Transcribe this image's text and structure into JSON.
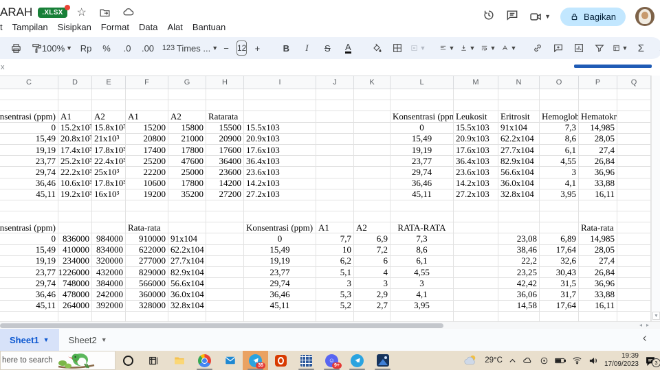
{
  "titlebar": {
    "title": "ARAH",
    "badge": ".XLSX",
    "share": "Bagikan"
  },
  "menubar": {
    "items": [
      "t",
      "Tampilan",
      "Sisipkan",
      "Format",
      "Data",
      "Alat",
      "Bantuan"
    ]
  },
  "toolbar": {
    "zoom": "100%",
    "currency": "Rp",
    "percent": "%",
    "decrease_decimal": ".0",
    "increase_decimal": ".00",
    "number_format": "123",
    "font": "Times ...",
    "minus": "−",
    "size": "12",
    "plus": "+",
    "bold": "B",
    "italic": "I",
    "strike": "S",
    "text_color": "A",
    "sum": "Σ",
    "collapse": "∧"
  },
  "formula_bar": {
    "remnant": "x"
  },
  "grid": {
    "column_headers": [
      "C",
      "D",
      "E",
      "F",
      "G",
      "H",
      "I",
      "J",
      "K",
      "L",
      "M",
      "N",
      "O",
      "P",
      "Q"
    ],
    "rows": [
      [],
      [],
      [
        [
          "C",
          "Konsentrasi (ppm)",
          "r"
        ],
        [
          "D",
          "A1",
          "l"
        ],
        [
          "E",
          "A2",
          "l"
        ],
        [
          "F",
          "A1",
          "l"
        ],
        [
          "G",
          "A2",
          "l"
        ],
        [
          "H",
          "Ratarata",
          "l"
        ],
        [
          "L",
          "Konsentrasi (ppm)",
          "l"
        ],
        [
          "M",
          "Leukosit",
          "l"
        ],
        [
          "N",
          "Eritrosit",
          "l"
        ],
        [
          "O",
          "Hemoglobin",
          "l"
        ],
        [
          "P",
          "Hematokrit",
          "l"
        ]
      ],
      [
        [
          "C",
          "0",
          "r"
        ],
        [
          "D",
          "15.2x10³",
          "l"
        ],
        [
          "E",
          "15.8x10³",
          "l"
        ],
        [
          "F",
          "15200",
          "r"
        ],
        [
          "G",
          "15800",
          "r"
        ],
        [
          "H",
          "15500",
          "r"
        ],
        [
          "I",
          "15.5x103",
          "l"
        ],
        [
          "L",
          "0",
          "c"
        ],
        [
          "M",
          "15.5x103",
          "l"
        ],
        [
          "N",
          "91x104",
          "l"
        ],
        [
          "O",
          "7,3",
          "r"
        ],
        [
          "P",
          "14,985",
          "r"
        ]
      ],
      [
        [
          "C",
          "15,49",
          "r"
        ],
        [
          "D",
          "20.8x10³",
          "l"
        ],
        [
          "E",
          "21x10³",
          "l"
        ],
        [
          "F",
          "20800",
          "r"
        ],
        [
          "G",
          "21000",
          "r"
        ],
        [
          "H",
          "20900",
          "r"
        ],
        [
          "I",
          "20.9x103",
          "l"
        ],
        [
          "L",
          "15,49",
          "c"
        ],
        [
          "M",
          "20.9x103",
          "l"
        ],
        [
          "N",
          "62.2x104",
          "l"
        ],
        [
          "O",
          "8,6",
          "r"
        ],
        [
          "P",
          "28,05",
          "r"
        ]
      ],
      [
        [
          "C",
          "19,19",
          "r"
        ],
        [
          "D",
          "17.4x10³",
          "l"
        ],
        [
          "E",
          "17.8x10³",
          "l"
        ],
        [
          "F",
          "17400",
          "r"
        ],
        [
          "G",
          "17800",
          "r"
        ],
        [
          "H",
          "17600",
          "r"
        ],
        [
          "I",
          "17.6x103",
          "l"
        ],
        [
          "L",
          "19,19",
          "c"
        ],
        [
          "M",
          "17.6x103",
          "l"
        ],
        [
          "N",
          "27.7x104",
          "l"
        ],
        [
          "O",
          "6,1",
          "r"
        ],
        [
          "P",
          "27,4",
          "r"
        ]
      ],
      [
        [
          "C",
          "23,77",
          "r"
        ],
        [
          "D",
          "25.2x10³",
          "l"
        ],
        [
          "E",
          "22.4x10³",
          "l"
        ],
        [
          "F",
          "25200",
          "r"
        ],
        [
          "G",
          "47600",
          "r"
        ],
        [
          "H",
          "36400",
          "r"
        ],
        [
          "I",
          "36.4x103",
          "l"
        ],
        [
          "L",
          "23,77",
          "c"
        ],
        [
          "M",
          "36.4x103",
          "l"
        ],
        [
          "N",
          "82.9x104",
          "l"
        ],
        [
          "O",
          "4,55",
          "r"
        ],
        [
          "P",
          "26,84",
          "r"
        ]
      ],
      [
        [
          "C",
          "29,74",
          "r"
        ],
        [
          "D",
          "22.2x10³",
          "l"
        ],
        [
          "E",
          "25x10³",
          "l"
        ],
        [
          "F",
          "22200",
          "r"
        ],
        [
          "G",
          "25000",
          "r"
        ],
        [
          "H",
          "23600",
          "r"
        ],
        [
          "I",
          "23.6x103",
          "l"
        ],
        [
          "L",
          "29,74",
          "c"
        ],
        [
          "M",
          "23.6x103",
          "l"
        ],
        [
          "N",
          "56.6x104",
          "l"
        ],
        [
          "O",
          "3",
          "r"
        ],
        [
          "P",
          "36,96",
          "r"
        ]
      ],
      [
        [
          "C",
          "36,46",
          "r"
        ],
        [
          "D",
          "10.6x10³",
          "l"
        ],
        [
          "E",
          "17.8x10³",
          "l"
        ],
        [
          "F",
          "10600",
          "r"
        ],
        [
          "G",
          "17800",
          "r"
        ],
        [
          "H",
          "14200",
          "r"
        ],
        [
          "I",
          "14.2x103",
          "l"
        ],
        [
          "L",
          "36,46",
          "c"
        ],
        [
          "M",
          "14.2x103",
          "l"
        ],
        [
          "N",
          "36.0x104",
          "l"
        ],
        [
          "O",
          "4,1",
          "r"
        ],
        [
          "P",
          "33,88",
          "r"
        ]
      ],
      [
        [
          "C",
          "45,11",
          "r"
        ],
        [
          "D",
          "19.2x10³",
          "l"
        ],
        [
          "E",
          "16x10³",
          "l"
        ],
        [
          "F",
          "19200",
          "r"
        ],
        [
          "G",
          "35200",
          "r"
        ],
        [
          "H",
          "27200",
          "r"
        ],
        [
          "I",
          "27.2x103",
          "l"
        ],
        [
          "L",
          "45,11",
          "c"
        ],
        [
          "M",
          "27.2x103",
          "l"
        ],
        [
          "N",
          "32.8x104",
          "l"
        ],
        [
          "O",
          "3,95",
          "r"
        ],
        [
          "P",
          "16,11",
          "r"
        ]
      ],
      [],
      [],
      [
        [
          "C",
          "Konsentrasi (ppm)",
          "r"
        ],
        [
          "F",
          "Rata-rata",
          "l"
        ],
        [
          "I",
          "Konsentrasi (ppm)",
          "l"
        ],
        [
          "J",
          "A1",
          "l"
        ],
        [
          "K",
          "A2",
          "l"
        ],
        [
          "L",
          "RATA-RATA",
          "c"
        ],
        [
          "P",
          "Rata-rata",
          "l"
        ]
      ],
      [
        [
          "C",
          "0",
          "r"
        ],
        [
          "D",
          "836000",
          "r"
        ],
        [
          "E",
          "984000",
          "r"
        ],
        [
          "F",
          "910000",
          "r"
        ],
        [
          "G",
          "91x104",
          "l"
        ],
        [
          "I",
          "0",
          "c"
        ],
        [
          "J",
          "7,7",
          "r"
        ],
        [
          "K",
          "6,9",
          "r"
        ],
        [
          "L",
          "7,3",
          "c"
        ],
        [
          "N",
          "23,08",
          "r"
        ],
        [
          "O",
          "6,89",
          "r"
        ],
        [
          "P",
          "14,985",
          "r"
        ]
      ],
      [
        [
          "C",
          "15,49",
          "r"
        ],
        [
          "D",
          "410000",
          "r"
        ],
        [
          "E",
          "834000",
          "r"
        ],
        [
          "F",
          "622000",
          "r"
        ],
        [
          "G",
          "62.2x104",
          "l"
        ],
        [
          "I",
          "15,49",
          "c"
        ],
        [
          "J",
          "10",
          "r"
        ],
        [
          "K",
          "7,2",
          "r"
        ],
        [
          "L",
          "8,6",
          "c"
        ],
        [
          "N",
          "38,46",
          "r"
        ],
        [
          "O",
          "17,64",
          "r"
        ],
        [
          "P",
          "28,05",
          "r"
        ]
      ],
      [
        [
          "C",
          "19,19",
          "r"
        ],
        [
          "D",
          "234000",
          "r"
        ],
        [
          "E",
          "320000",
          "r"
        ],
        [
          "F",
          "277000",
          "r"
        ],
        [
          "G",
          "27.7x104",
          "l"
        ],
        [
          "I",
          "19,19",
          "c"
        ],
        [
          "J",
          "6,2",
          "r"
        ],
        [
          "K",
          "6",
          "r"
        ],
        [
          "L",
          "6,1",
          "c"
        ],
        [
          "N",
          "22,2",
          "r"
        ],
        [
          "O",
          "32,6",
          "r"
        ],
        [
          "P",
          "27,4",
          "r"
        ]
      ],
      [
        [
          "C",
          "23,77",
          "r"
        ],
        [
          "D",
          "1226000",
          "r"
        ],
        [
          "E",
          "432000",
          "r"
        ],
        [
          "F",
          "829000",
          "r"
        ],
        [
          "G",
          "82.9x104",
          "l"
        ],
        [
          "I",
          "23,77",
          "c"
        ],
        [
          "J",
          "5,1",
          "r"
        ],
        [
          "K",
          "4",
          "r"
        ],
        [
          "L",
          "4,55",
          "c"
        ],
        [
          "N",
          "23,25",
          "r"
        ],
        [
          "O",
          "30,43",
          "r"
        ],
        [
          "P",
          "26,84",
          "r"
        ]
      ],
      [
        [
          "C",
          "29,74",
          "r"
        ],
        [
          "D",
          "748000",
          "r"
        ],
        [
          "E",
          "384000",
          "r"
        ],
        [
          "F",
          "566000",
          "r"
        ],
        [
          "G",
          "56.6x104",
          "l"
        ],
        [
          "I",
          "29,74",
          "c"
        ],
        [
          "J",
          "3",
          "r"
        ],
        [
          "K",
          "3",
          "r"
        ],
        [
          "L",
          "3",
          "c"
        ],
        [
          "N",
          "42,42",
          "r"
        ],
        [
          "O",
          "31,5",
          "r"
        ],
        [
          "P",
          "36,96",
          "r"
        ]
      ],
      [
        [
          "C",
          "36,46",
          "r"
        ],
        [
          "D",
          "478000",
          "r"
        ],
        [
          "E",
          "242000",
          "r"
        ],
        [
          "F",
          "360000",
          "r"
        ],
        [
          "G",
          "36.0x104",
          "l"
        ],
        [
          "I",
          "36,46",
          "c"
        ],
        [
          "J",
          "5,3",
          "r"
        ],
        [
          "K",
          "2,9",
          "r"
        ],
        [
          "L",
          "4,1",
          "c"
        ],
        [
          "N",
          "36,06",
          "r"
        ],
        [
          "O",
          "31,7",
          "r"
        ],
        [
          "P",
          "33,88",
          "r"
        ]
      ],
      [
        [
          "C",
          "45,11",
          "r"
        ],
        [
          "D",
          "264000",
          "r"
        ],
        [
          "E",
          "392000",
          "r"
        ],
        [
          "F",
          "328000",
          "r"
        ],
        [
          "G",
          "32.8x104",
          "l"
        ],
        [
          "I",
          "45,11",
          "c"
        ],
        [
          "J",
          "5,2",
          "r"
        ],
        [
          "K",
          "2,7",
          "r"
        ],
        [
          "L",
          "3,95",
          "c"
        ],
        [
          "N",
          "14,58",
          "r"
        ],
        [
          "O",
          "17,64",
          "r"
        ],
        [
          "P",
          "16,11",
          "r"
        ]
      ],
      []
    ]
  },
  "tabs": {
    "sheet1": "Sheet1",
    "sheet2": "Sheet2"
  },
  "taskbar": {
    "search": "here to search",
    "weather_temp": "29°C",
    "time": "19:39",
    "date": "17/09/2023",
    "telegram_badge": "35",
    "discord_badge": "9+",
    "notif_badge": "3"
  }
}
